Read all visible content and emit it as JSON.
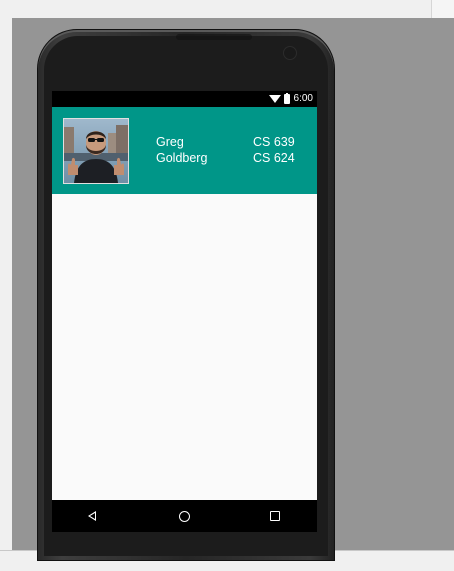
{
  "status_bar": {
    "time": "6:00",
    "icons": [
      "wifi-icon",
      "battery-icon"
    ]
  },
  "profile": {
    "first_name": "Greg",
    "last_name": "Goldberg",
    "photo_icon": "person-thumbs-up-photo"
  },
  "courses": [
    {
      "label": "CS 639"
    },
    {
      "label": "CS 624"
    }
  ],
  "nav_bar": {
    "buttons": [
      "back-icon",
      "home-icon",
      "recents-icon"
    ]
  },
  "colors": {
    "app_bar": "#009688",
    "screen_background": "#fafafa",
    "emulator_background": "#959595"
  }
}
